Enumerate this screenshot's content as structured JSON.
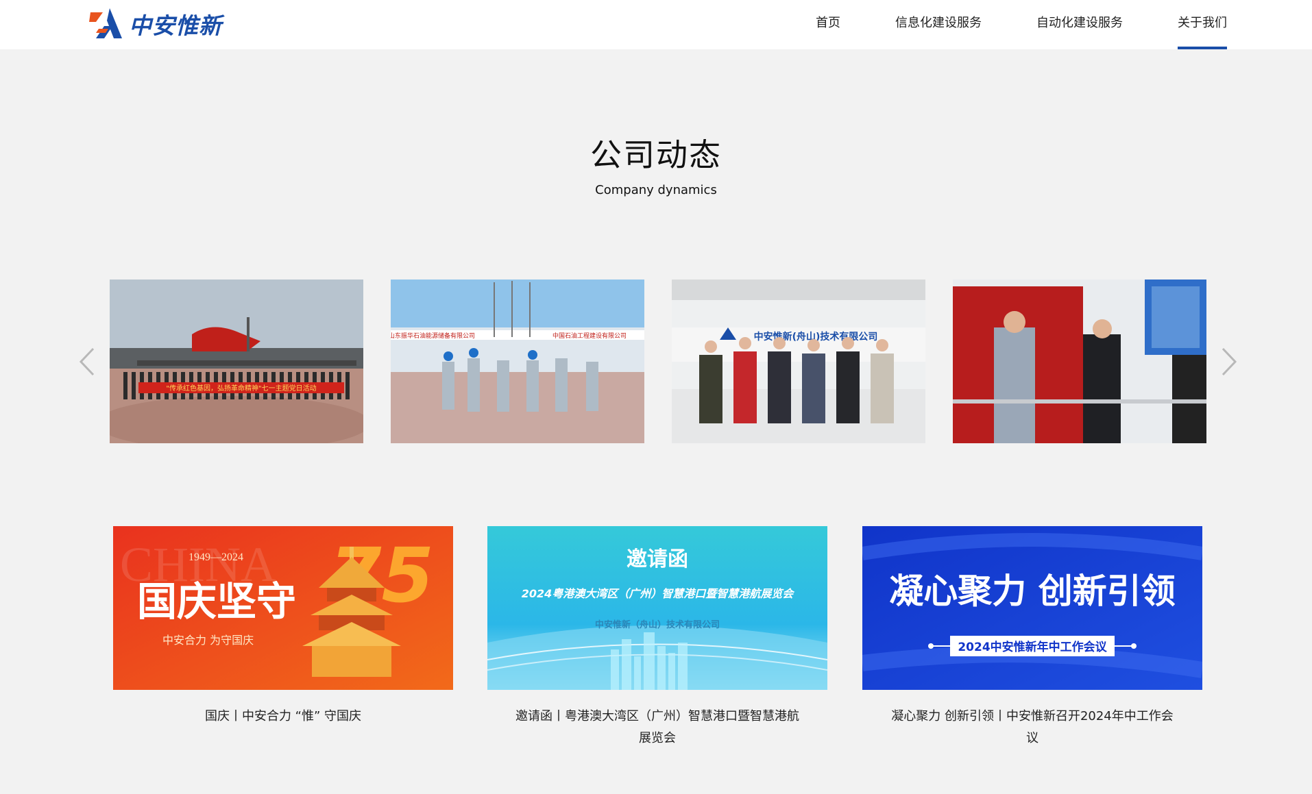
{
  "header": {
    "brand": "中安惟新",
    "nav": [
      {
        "label": "首页",
        "active": false
      },
      {
        "label": "信息化建设服务",
        "active": false
      },
      {
        "label": "自动化建设服务",
        "active": false
      },
      {
        "label": "关于我们",
        "active": true
      }
    ]
  },
  "section": {
    "title": "公司动态",
    "subtitle": "Company dynamics"
  },
  "carousel": {
    "prev_icon": "chevron-left-icon",
    "next_icon": "chevron-right-icon",
    "slides": [
      {
        "banner_text": "\"传承红色基因，弘扬革命精神\"七一主题党日活动"
      },
      {
        "sign_left": "山东振华石油能源储备有限公司",
        "sign_right": "中国石油工程建设有限公司"
      },
      {
        "sign_text": "中安惟新(舟山)技术有限公司"
      },
      {
        "sign_text": ""
      }
    ]
  },
  "news": [
    {
      "banner": {
        "years": "1949—2024",
        "watermark": "CHINA",
        "number": "75",
        "headline": "国庆坚守",
        "tagline": "中安合力  为守国庆"
      },
      "caption": "国庆丨中安合力 “惟” 守国庆"
    },
    {
      "banner": {
        "headline": "邀请函",
        "subhead": "2024粤港澳大湾区（广州）智慧港口暨智慧港航展览会",
        "company": "中安惟新（舟山）技术有限公司"
      },
      "caption": "邀请函丨粤港澳大湾区（广州）智慧港口暨智慧港航展览会"
    },
    {
      "banner": {
        "headline": "凝心聚力  创新引领",
        "subhead": "2024中安惟新年中工作会议"
      },
      "caption": "凝心聚力 创新引领丨中安惟新召开2024年中工作会议"
    }
  ],
  "colors": {
    "brand_blue": "#1a4ea8",
    "brand_orange": "#e8541e",
    "page_bg": "#f2f2f2"
  }
}
